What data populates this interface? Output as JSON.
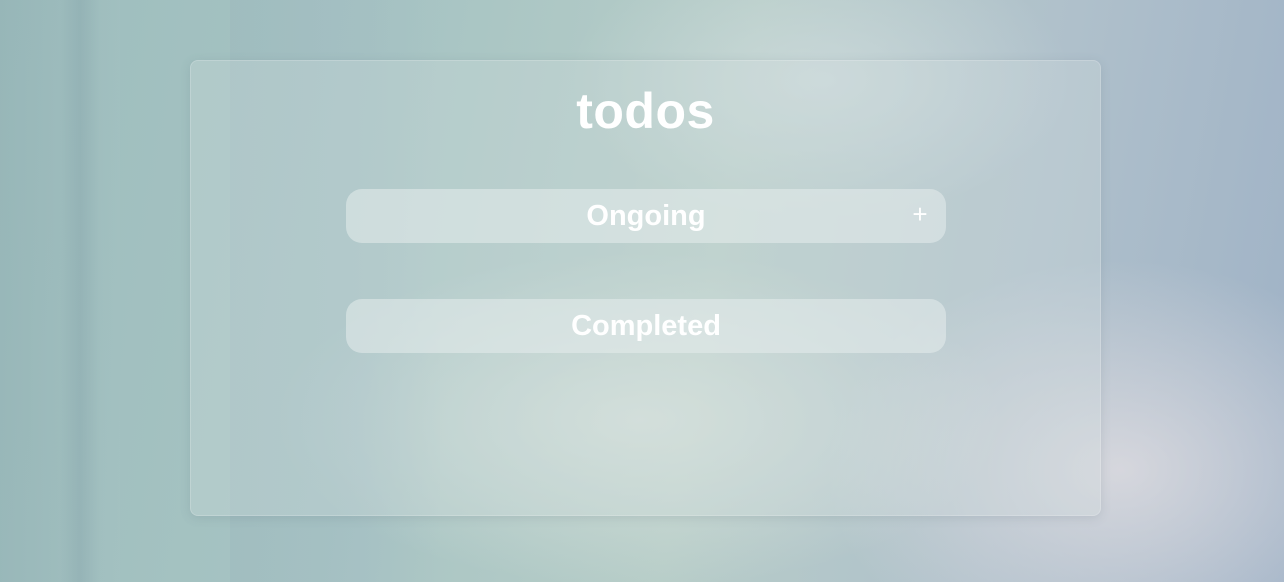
{
  "app": {
    "title": "todos"
  },
  "sections": {
    "ongoing": {
      "label": "Ongoing",
      "add_icon": "+"
    },
    "completed": {
      "label": "Completed"
    }
  },
  "icons": {
    "add": "plus-icon"
  },
  "colors": {
    "text": "#ffffff",
    "header_bg": "rgba(230,236,236,0.55)",
    "card_bg": "rgba(214,226,226,0.28)"
  }
}
